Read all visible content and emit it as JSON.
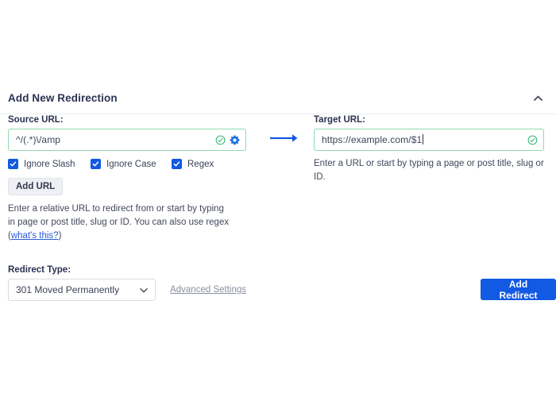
{
  "panel": {
    "title": "Add New Redirection",
    "collapse_icon": "chevron-up-icon"
  },
  "source": {
    "label": "Source URL:",
    "value": "^/(.*)\\/amp",
    "valid_icon": "check-circle-icon",
    "settings_icon": "gear-icon",
    "help_text_prefix": "Enter a relative URL to redirect from or start by typing in page or post title, slug or ID. You can also use regex (",
    "help_link": "what's this?",
    "help_text_suffix": ")"
  },
  "flow": {
    "arrow_icon": "arrow-right-icon"
  },
  "target": {
    "label": "Target URL:",
    "value": "https://example.com/$1",
    "valid_icon": "check-circle-icon",
    "help_text": "Enter a URL or start by typing a page or post title, slug or ID."
  },
  "options": [
    {
      "label": "Ignore Slash",
      "checked": true
    },
    {
      "label": "Ignore Case",
      "checked": true
    },
    {
      "label": "Regex",
      "checked": true
    }
  ],
  "add_url_button": "Add URL",
  "redirect_type": {
    "label": "Redirect Type:",
    "selected": "301 Moved Permanently",
    "chevron_icon": "chevron-down-icon",
    "advanced_link": "Advanced Settings"
  },
  "submit_button": "Add Redirect",
  "colors": {
    "accent_blue": "#1259e3",
    "valid_green": "#8fd8b0",
    "title_navy": "#2c3251",
    "link_blue": "#2a5bd7"
  }
}
